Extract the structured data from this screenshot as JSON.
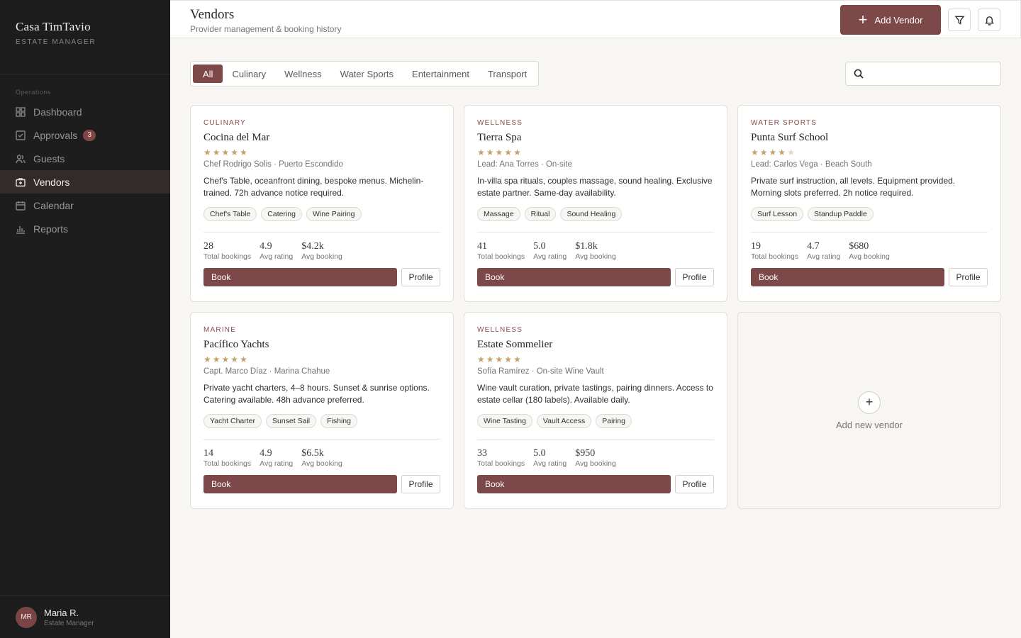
{
  "brand": {
    "name": "Casa TimTavio",
    "subtitle": "ESTATE MANAGER"
  },
  "sidebar": {
    "section_label": "Operations",
    "items": [
      {
        "label": "Dashboard",
        "icon": "grid-icon"
      },
      {
        "label": "Approvals",
        "icon": "check-square-icon",
        "badge": "3"
      },
      {
        "label": "Guests",
        "icon": "users-icon"
      },
      {
        "label": "Vendors",
        "icon": "briefcase-icon",
        "active": true
      },
      {
        "label": "Calendar",
        "icon": "calendar-icon"
      },
      {
        "label": "Reports",
        "icon": "bar-chart-icon"
      }
    ]
  },
  "user": {
    "initials": "MR",
    "name": "Maria R.",
    "role": "Estate Manager"
  },
  "header": {
    "title": "Vendors",
    "subtitle": "Provider management & booking history",
    "add_button": "Add Vendor"
  },
  "filters": {
    "tabs": [
      "All",
      "Culinary",
      "Wellness",
      "Water Sports",
      "Entertainment",
      "Transport"
    ],
    "active": "All"
  },
  "search": {
    "value": "",
    "placeholder": ""
  },
  "stat_labels": {
    "bookings": "Total bookings",
    "rating": "Avg rating",
    "avg": "Avg booking"
  },
  "buttons": {
    "book": "Book",
    "profile": "Profile"
  },
  "vendors": [
    {
      "category": "CULINARY",
      "name": "Cocina del Mar",
      "rating_stars": 5,
      "meta": "Chef Rodrigo Solis · Puerto Escondido",
      "description": "Chef's Table, oceanfront dining, bespoke menus. Michelin-trained. 72h advance notice required.",
      "tags": [
        "Chef's Table",
        "Catering",
        "Wine Pairing"
      ],
      "bookings": "28",
      "rating": "4.9",
      "avg_booking": "$4.2k"
    },
    {
      "category": "WELLNESS",
      "name": "Tierra Spa",
      "rating_stars": 5,
      "meta": "Lead: Ana Torres · On-site",
      "description": "In-villa spa rituals, couples massage, sound healing. Exclusive estate partner. Same-day availability.",
      "tags": [
        "Massage",
        "Ritual",
        "Sound Healing"
      ],
      "bookings": "41",
      "rating": "5.0",
      "avg_booking": "$1.8k"
    },
    {
      "category": "WATER SPORTS",
      "name": "Punta Surf School",
      "rating_stars": 4,
      "meta": "Lead: Carlos Vega · Beach South",
      "description": "Private surf instruction, all levels. Equipment provided. Morning slots preferred. 2h notice required.",
      "tags": [
        "Surf Lesson",
        "Standup Paddle"
      ],
      "bookings": "19",
      "rating": "4.7",
      "avg_booking": "$680"
    },
    {
      "category": "MARINE",
      "name": "Pacífico Yachts",
      "rating_stars": 5,
      "meta": "Capt. Marco Díaz · Marina Chahue",
      "description": "Private yacht charters, 4–8 hours. Sunset & sunrise options. Catering available. 48h advance preferred.",
      "tags": [
        "Yacht Charter",
        "Sunset Sail",
        "Fishing"
      ],
      "bookings": "14",
      "rating": "4.9",
      "avg_booking": "$6.5k"
    },
    {
      "category": "WELLNESS",
      "name": "Estate Sommelier",
      "rating_stars": 5,
      "meta": "Sofía Ramírez · On-site Wine Vault",
      "description": "Wine vault curation, private tastings, pairing dinners. Access to estate cellar (180 labels). Available daily.",
      "tags": [
        "Wine Tasting",
        "Vault Access",
        "Pairing"
      ],
      "bookings": "33",
      "rating": "5.0",
      "avg_booking": "$950"
    }
  ],
  "add_card": {
    "label": "Add new vendor"
  },
  "colors": {
    "accent": "#7d4848",
    "sidebar_bg": "#1e1d1d",
    "star": "#c6a06c"
  }
}
